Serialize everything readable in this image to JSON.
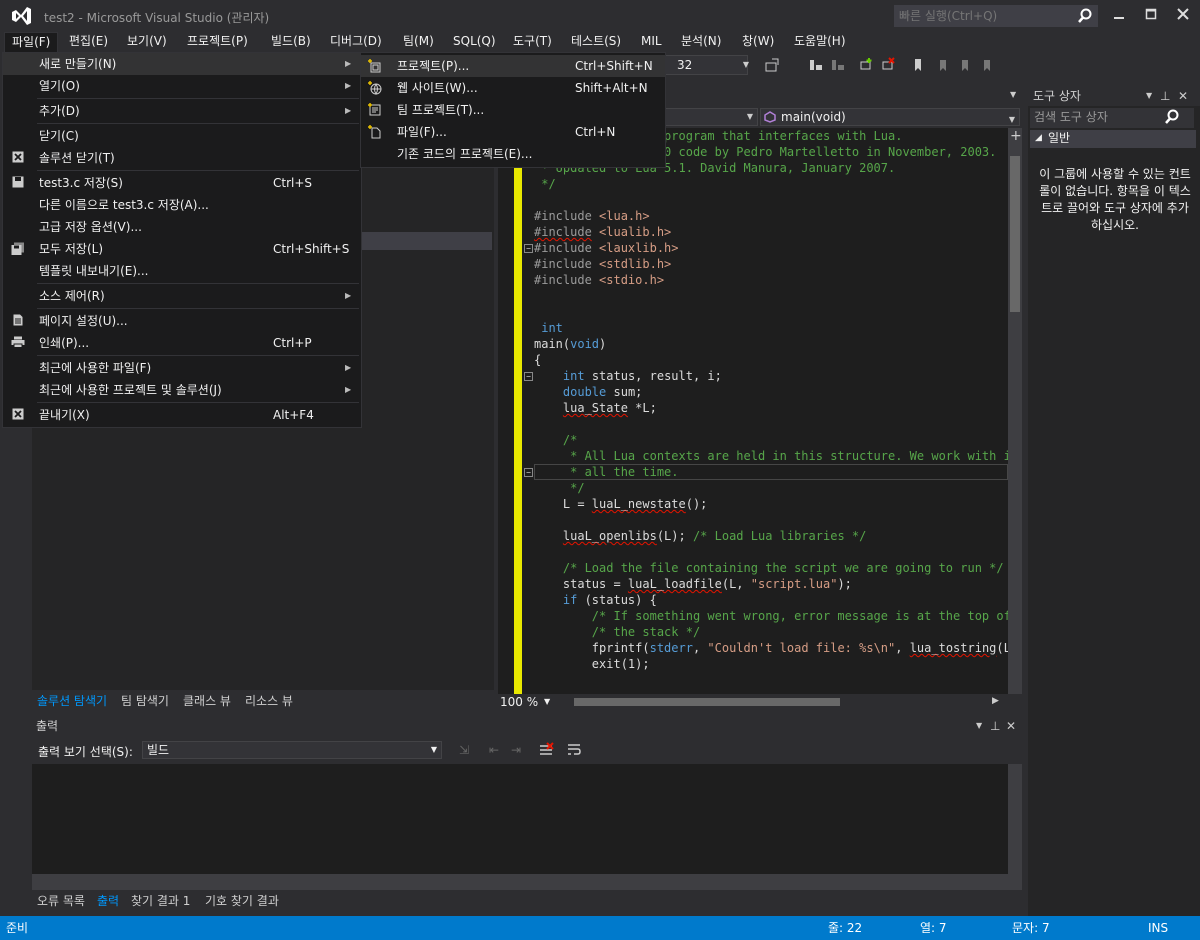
{
  "window": {
    "title": "test2 - Microsoft Visual Studio (관리자)",
    "quick_launch_placeholder": "빠른 실행(Ctrl+Q)"
  },
  "menubar": [
    "파일(F)",
    "편집(E)",
    "보기(V)",
    "프로젝트(P)",
    "빌드(B)",
    "디버그(D)",
    "팀(M)",
    "SQL(Q)",
    "도구(T)",
    "테스트(S)",
    "MIL",
    "분석(N)",
    "창(W)",
    "도움말(H)"
  ],
  "toolbar": {
    "config": "32"
  },
  "file_menu": {
    "items": [
      {
        "label": "새로 만들기(N)",
        "shortcut": "",
        "submenu": true,
        "icon": ""
      },
      {
        "label": "열기(O)",
        "shortcut": "",
        "submenu": true,
        "icon": ""
      },
      {
        "label": "추가(D)",
        "shortcut": "",
        "submenu": true,
        "icon": ""
      },
      {
        "label": "닫기(C)",
        "shortcut": "",
        "submenu": false,
        "icon": ""
      },
      {
        "label": "솔루션 닫기(T)",
        "shortcut": "",
        "submenu": false,
        "icon": "close-solution-icon"
      },
      {
        "label": "test3.c 저장(S)",
        "shortcut": "Ctrl+S",
        "submenu": false,
        "icon": "save-icon"
      },
      {
        "label": "다른 이름으로 test3.c 저장(A)...",
        "shortcut": "",
        "submenu": false,
        "icon": ""
      },
      {
        "label": "고급 저장 옵션(V)...",
        "shortcut": "",
        "submenu": false,
        "icon": ""
      },
      {
        "label": "모두 저장(L)",
        "shortcut": "Ctrl+Shift+S",
        "submenu": false,
        "icon": "save-all-icon"
      },
      {
        "label": "템플릿 내보내기(E)...",
        "shortcut": "",
        "submenu": false,
        "icon": ""
      },
      {
        "label": "소스 제어(R)",
        "shortcut": "",
        "submenu": true,
        "icon": ""
      },
      {
        "label": "페이지 설정(U)...",
        "shortcut": "",
        "submenu": false,
        "icon": "page-setup-icon"
      },
      {
        "label": "인쇄(P)...",
        "shortcut": "Ctrl+P",
        "submenu": false,
        "icon": "print-icon"
      },
      {
        "label": "최근에 사용한 파일(F)",
        "shortcut": "",
        "submenu": true,
        "icon": ""
      },
      {
        "label": "최근에 사용한 프로젝트 및 솔루션(J)",
        "shortcut": "",
        "submenu": true,
        "icon": ""
      },
      {
        "label": "끝내기(X)",
        "shortcut": "Alt+F4",
        "submenu": false,
        "icon": "exit-icon"
      }
    ]
  },
  "new_submenu": {
    "items": [
      {
        "label": "프로젝트(P)...",
        "shortcut": "Ctrl+Shift+N",
        "icon": "new-project-icon"
      },
      {
        "label": "웹 사이트(W)...",
        "shortcut": "Shift+Alt+N",
        "icon": "new-website-icon"
      },
      {
        "label": "팀 프로젝트(T)...",
        "shortcut": "",
        "icon": "team-project-icon"
      },
      {
        "label": "파일(F)...",
        "shortcut": "Ctrl+N",
        "icon": "new-file-icon"
      },
      {
        "label": "기존 코드의 프로젝트(E)...",
        "shortcut": "",
        "icon": ""
      }
    ]
  },
  "editor": {
    "nav_function": "main(void)",
    "zoom": "100 %"
  },
  "left_tabs": [
    "솔루션 탐색기",
    "팀 탐색기",
    "클래스 뷰",
    "리소스 뷰"
  ],
  "toolbox": {
    "title": "도구 상자",
    "search_placeholder": "검색 도구 상자",
    "group": "일반",
    "empty_message": "이 그룹에 사용할 수 있는 컨트롤이 없습니다. 항목을 이 텍스트로 끌어와 도구 상자에 추가하십시오."
  },
  "output": {
    "title": "출력",
    "select_label": "출력 보기 선택(S):",
    "select_value": "빌드"
  },
  "output_tabs": [
    "오류 목록",
    "출력",
    "찾기 결과 1",
    "기호 찾기 결과"
  ],
  "status": {
    "ready": "준비",
    "line": "줄: 22",
    "col": "열: 7",
    "char": "문자: 7",
    "mode": "INS"
  },
  "colors": {
    "accent": "#007acc",
    "background": "#2d2d30",
    "editor_bg": "#1e1e1e",
    "active_tab": "#0097fb"
  }
}
